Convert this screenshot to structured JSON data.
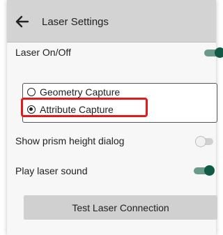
{
  "appbar": {
    "title": "Laser Settings",
    "back_icon": "arrow-left-icon"
  },
  "settings": {
    "laser_toggle": {
      "label": "Laser On/Off",
      "state": true
    },
    "capture_mode": {
      "options": [
        {
          "label": "Geometry Capture",
          "selected": false
        },
        {
          "label": "Attribute Capture",
          "selected": true
        }
      ]
    },
    "prism_dialog": {
      "label": "Show prism height dialog",
      "state": false
    },
    "laser_sound": {
      "label": "Play laser sound",
      "state": true
    }
  },
  "actions": {
    "test_button": "Test Laser Connection"
  },
  "colors": {
    "toggle_on": "#0f5b46",
    "highlight": "#e3191c",
    "appbar_bg": "#d3d3d3",
    "button_bg": "#d0d0d0"
  }
}
